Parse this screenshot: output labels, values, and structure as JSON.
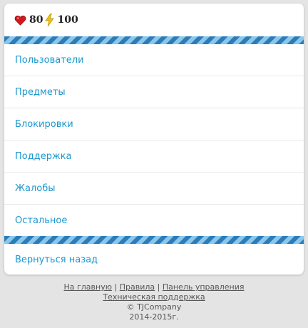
{
  "stats": {
    "health_icon": "heart-icon",
    "health": "80",
    "energy_icon": "lightning-icon",
    "energy": "100",
    "colors": {
      "heart": "#d0191d",
      "bolt": "#f2c500"
    }
  },
  "menu": {
    "items": [
      {
        "label": "Пользователи"
      },
      {
        "label": "Предметы"
      },
      {
        "label": "Блокировки"
      },
      {
        "label": "Поддержка"
      },
      {
        "label": "Жалобы"
      },
      {
        "label": "Остальное"
      }
    ],
    "back_label": "Вернуться назад"
  },
  "footer": {
    "links": {
      "home": "На главную",
      "rules": "Правила",
      "control_panel": "Панель управления",
      "support": "Техническая поддержка"
    },
    "separator": "|",
    "copyright": "© TJCompany",
    "years": "2014-2015г."
  },
  "colors": {
    "link": "#1c97cf",
    "stripe_dark": "#2b7db8",
    "stripe_light": "#8bc6ec",
    "background": "#e4e4e4"
  }
}
